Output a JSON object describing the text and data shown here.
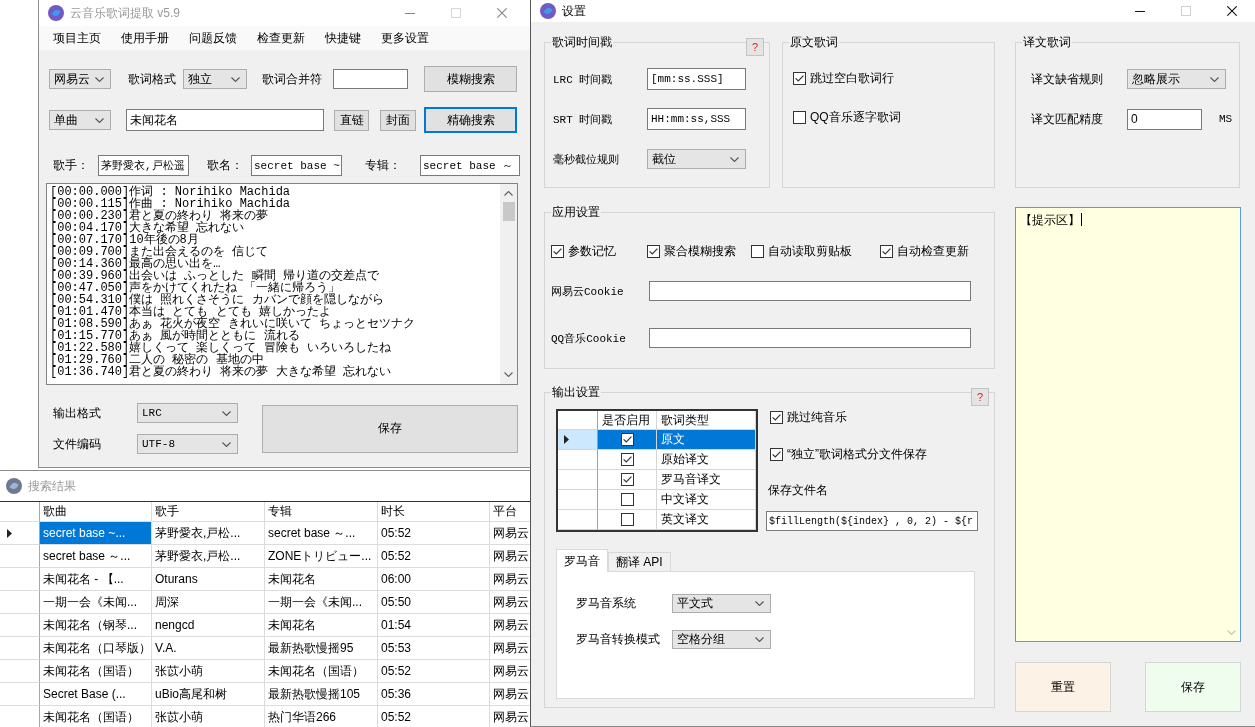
{
  "main_window": {
    "title": "云音乐歌词提取 v5.9",
    "active": false,
    "can_maximize": false,
    "menu": [
      "项目主页",
      "使用手册",
      "问题反馈",
      "检查更新",
      "快捷键",
      "更多设置"
    ],
    "search_row": {
      "source": "网易云",
      "format_label": "歌词格式",
      "format": "独立",
      "merge_label": "歌词合并符",
      "fuzzy_button": {
        "label": "模糊搜索",
        "focused": false
      }
    },
    "query_row": {
      "search_type": "单曲",
      "query": "未闻花名",
      "link_button": "直链",
      "cover_button": "封面",
      "exact_button": {
        "label": "精确搜索",
        "focused": true
      }
    },
    "info": [
      {
        "label": "歌手：",
        "value": "茅野愛衣,戸松遥"
      },
      {
        "label": "歌名：",
        "value": "secret base ~"
      },
      {
        "label": "专辑：",
        "value": "secret base ～"
      }
    ],
    "lyrics": [
      "[00:00.000]作词 : Norihiko Machida",
      "[00:00.115]作曲 : Norihiko Machida",
      "[00:00.230]君と夏の終わり 将来の夢",
      "[00:04.170]大きな希望 忘れない",
      "[00:07.170]10年後の8月",
      "[00:09.700]また出会えるのを 信じて",
      "[00:14.360]最高の思い出を…",
      "[00:39.960]出会いは ふっとした 瞬間 帰り道の交差点で",
      "[00:47.050]声をかけてくれたね 「一緒に帰ろう」",
      "[00:54.310]僕は 照れくさそうに カバンで顔を隠しながら",
      "[01:01.470]本当は とても とても 嬉しかったよ",
      "[01:08.590]あぁ 花火が夜空 きれいに咲いて ちょっとセツナク",
      "[01:15.770]あぁ 風が時間とともに 流れる",
      "[01:22.580]嬉しくって 楽しくって 冒険も いろいろしたね",
      "[01:29.760]二人の 秘密の 基地の中",
      "[01:36.740]君と夏の終わり 将来の夢 大きな希望 忘れない"
    ],
    "output": [
      {
        "label": "输出格式",
        "value": "LRC"
      },
      {
        "label": "文件编码",
        "value": "UTF-8"
      }
    ],
    "save_button": "保存"
  },
  "results_window": {
    "title": "搜索结果",
    "active": false,
    "columns": [
      "歌曲",
      "歌手",
      "专辑",
      "时长",
      "平台"
    ],
    "rows": [
      {
        "selected": true,
        "cells": [
          "secret base ~...",
          "茅野愛衣,戸松...",
          "secret base ～...",
          "05:52",
          "网易云"
        ]
      },
      {
        "selected": false,
        "cells": [
          "secret base ～...",
          "茅野愛衣,戸松...",
          "ZONEトリビュー...",
          "05:52",
          "网易云"
        ]
      },
      {
        "selected": false,
        "cells": [
          "未闻花名 - 【...",
          "Oturans",
          "未闻花名",
          "06:00",
          "网易云"
        ]
      },
      {
        "selected": false,
        "cells": [
          "一期一会《未闻...",
          "周深",
          "一期一会《未闻...",
          "05:50",
          "网易云"
        ]
      },
      {
        "selected": false,
        "cells": [
          "未闻花名（钢琴...",
          "nengcd",
          "未闻花名",
          "01:54",
          "网易云"
        ]
      },
      {
        "selected": false,
        "cells": [
          "未闻花名（口琴版）",
          "V.A.",
          "最新热歌慢摇95",
          "05:53",
          "网易云"
        ]
      },
      {
        "selected": false,
        "cells": [
          "未闻花名（国语）",
          "张苡小萌",
          "未闻花名（国语）",
          "05:52",
          "网易云"
        ]
      },
      {
        "selected": false,
        "cells": [
          "Secret Base (...",
          "uBio高尾和树",
          "最新热歌慢摇105",
          "05:36",
          "网易云"
        ]
      },
      {
        "selected": false,
        "cells": [
          "未闻花名（国语）",
          "张苡小萌",
          "热门华语266",
          "05:52",
          "网易云"
        ]
      }
    ]
  },
  "settings_window": {
    "title": "设置",
    "active": true,
    "can_maximize": false,
    "timestamp_group": {
      "title": "歌词时间戳",
      "help": "?",
      "fields": [
        {
          "label": "LRC 时间戳",
          "kind": "input",
          "value": "[mm:ss.SSS]"
        },
        {
          "label": "SRT 时间戳",
          "kind": "input",
          "value": "HH:mm:ss,SSS"
        },
        {
          "label": "毫秒截位规则",
          "kind": "dropdown",
          "value": "截位"
        }
      ]
    },
    "original_group": {
      "title": "原文歌词",
      "options": [
        {
          "label": "跳过空白歌词行",
          "checked": true
        },
        {
          "label": "QQ音乐逐字歌词",
          "checked": false
        }
      ]
    },
    "translation_group": {
      "title": "译文歌词",
      "fields": [
        {
          "label": "译文缺省规则",
          "kind": "dropdown",
          "value": "忽略展示"
        },
        {
          "label": "译文匹配精度",
          "kind": "input",
          "value": "0",
          "unit": "MS"
        }
      ]
    },
    "app_group": {
      "title": "应用设置",
      "options": [
        {
          "label": "参数记忆",
          "checked": true
        },
        {
          "label": "聚合模糊搜索",
          "checked": true
        },
        {
          "label": "自动读取剪贴板",
          "checked": false
        },
        {
          "label": "自动检查更新",
          "checked": true
        }
      ],
      "cookies": [
        {
          "label": "网易云Cookie"
        },
        {
          "label": "QQ音乐Cookie"
        }
      ]
    },
    "output_group": {
      "title": "输出设置",
      "help": "?",
      "grid": {
        "columns": [
          "是否启用",
          "歌词类型"
        ],
        "rows": [
          {
            "checked": true,
            "type": "原文",
            "selected": true
          },
          {
            "checked": true,
            "type": "原始译文",
            "selected": false
          },
          {
            "checked": true,
            "type": "罗马音译文",
            "selected": false
          },
          {
            "checked": false,
            "type": "中文译文",
            "selected": false
          },
          {
            "checked": false,
            "type": "英文译文",
            "selected": false
          }
        ]
      },
      "options": [
        {
          "label": "跳过纯音乐",
          "checked": true
        },
        {
          "label": "“独立”歌词格式分文件保存",
          "checked": true
        }
      ],
      "filename_label": "保存文件名",
      "filename": "$fillLength(${index} , 0, 2) - ${r",
      "tabs": [
        {
          "label": "罗马音",
          "selected": true
        },
        {
          "label": "翻译 API",
          "selected": false
        }
      ],
      "romaji_fields": [
        {
          "label": "罗马音系统",
          "value": "平文式"
        },
        {
          "label": "罗马音转换模式",
          "value": "空格分组"
        }
      ]
    },
    "hint_area": {
      "text": "【提示区】"
    },
    "buttons": [
      {
        "label": "重置",
        "kind": "reset"
      },
      {
        "label": "保存",
        "kind": "save"
      }
    ]
  }
}
